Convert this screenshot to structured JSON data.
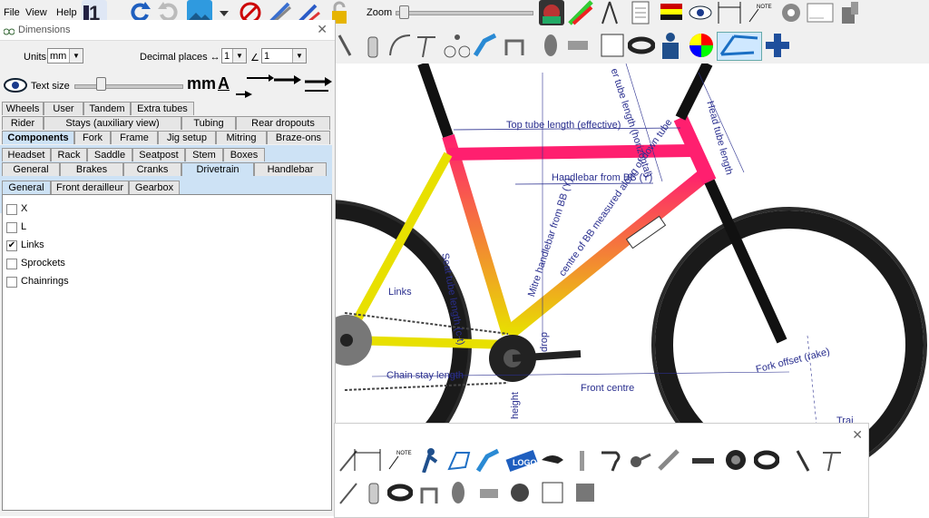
{
  "menubar": {
    "items": [
      "File",
      "View",
      "Help"
    ]
  },
  "zoom": {
    "label": "Zoom"
  },
  "dimensions_window": {
    "title": "Dimensions",
    "units_label": "Units",
    "units_value": "mm",
    "decimal_label": "Decimal places ↔",
    "decimal_value_linear": "1",
    "angle_symbol": "∠",
    "decimal_value_angle": "1",
    "text_size_label": "Text size",
    "text_size_sample": "mm",
    "text_size_sample2": "A",
    "tab_rows": [
      [
        "Wheels",
        "User",
        "Tandem",
        "Extra tubes"
      ],
      [
        "Rider",
        "Stays (auxiliary view)",
        "Tubing",
        "Rear dropouts"
      ],
      [
        "Components",
        "Fork",
        "Frame",
        "Jig setup",
        "Mitring",
        "Braze-ons"
      ],
      [
        "Headset",
        "Rack",
        "Saddle",
        "Seatpost",
        "Stem",
        "Boxes"
      ],
      [
        "General",
        "Brakes",
        "Cranks",
        "Drivetrain",
        "Handlebar"
      ]
    ],
    "sub_tabs": [
      "General",
      "Front derailleur",
      "Gearbox"
    ],
    "checkboxes": [
      {
        "label": "X",
        "checked": false
      },
      {
        "label": "L",
        "checked": false
      },
      {
        "label": "Links",
        "checked": true
      },
      {
        "label": "Sprockets",
        "checked": false
      },
      {
        "label": "Chainrings",
        "checked": false
      }
    ]
  },
  "canvas": {
    "labels": {
      "top_tube": "Top tube length (effective)",
      "handlebar_from_bb": "Handlebar from BB (Y)",
      "seat_tube": "Seat tube length (c-t)",
      "mitre": "Mitre handlebar from BB (Y)",
      "centre_bb": "centre of BB measured along of down tube",
      "head_tube": "Head tube length",
      "top_tube_horiz": "er tube length (horizontal)",
      "links": "Links",
      "chain_stay": "Chain stay length",
      "front_centre": "Front centre",
      "fork_offset": "Fork offset (rake)",
      "height": "height",
      "drop": "drop",
      "trail": "Trai"
    },
    "frame_colors": [
      "#ff1f6f",
      "#e8e000"
    ]
  }
}
